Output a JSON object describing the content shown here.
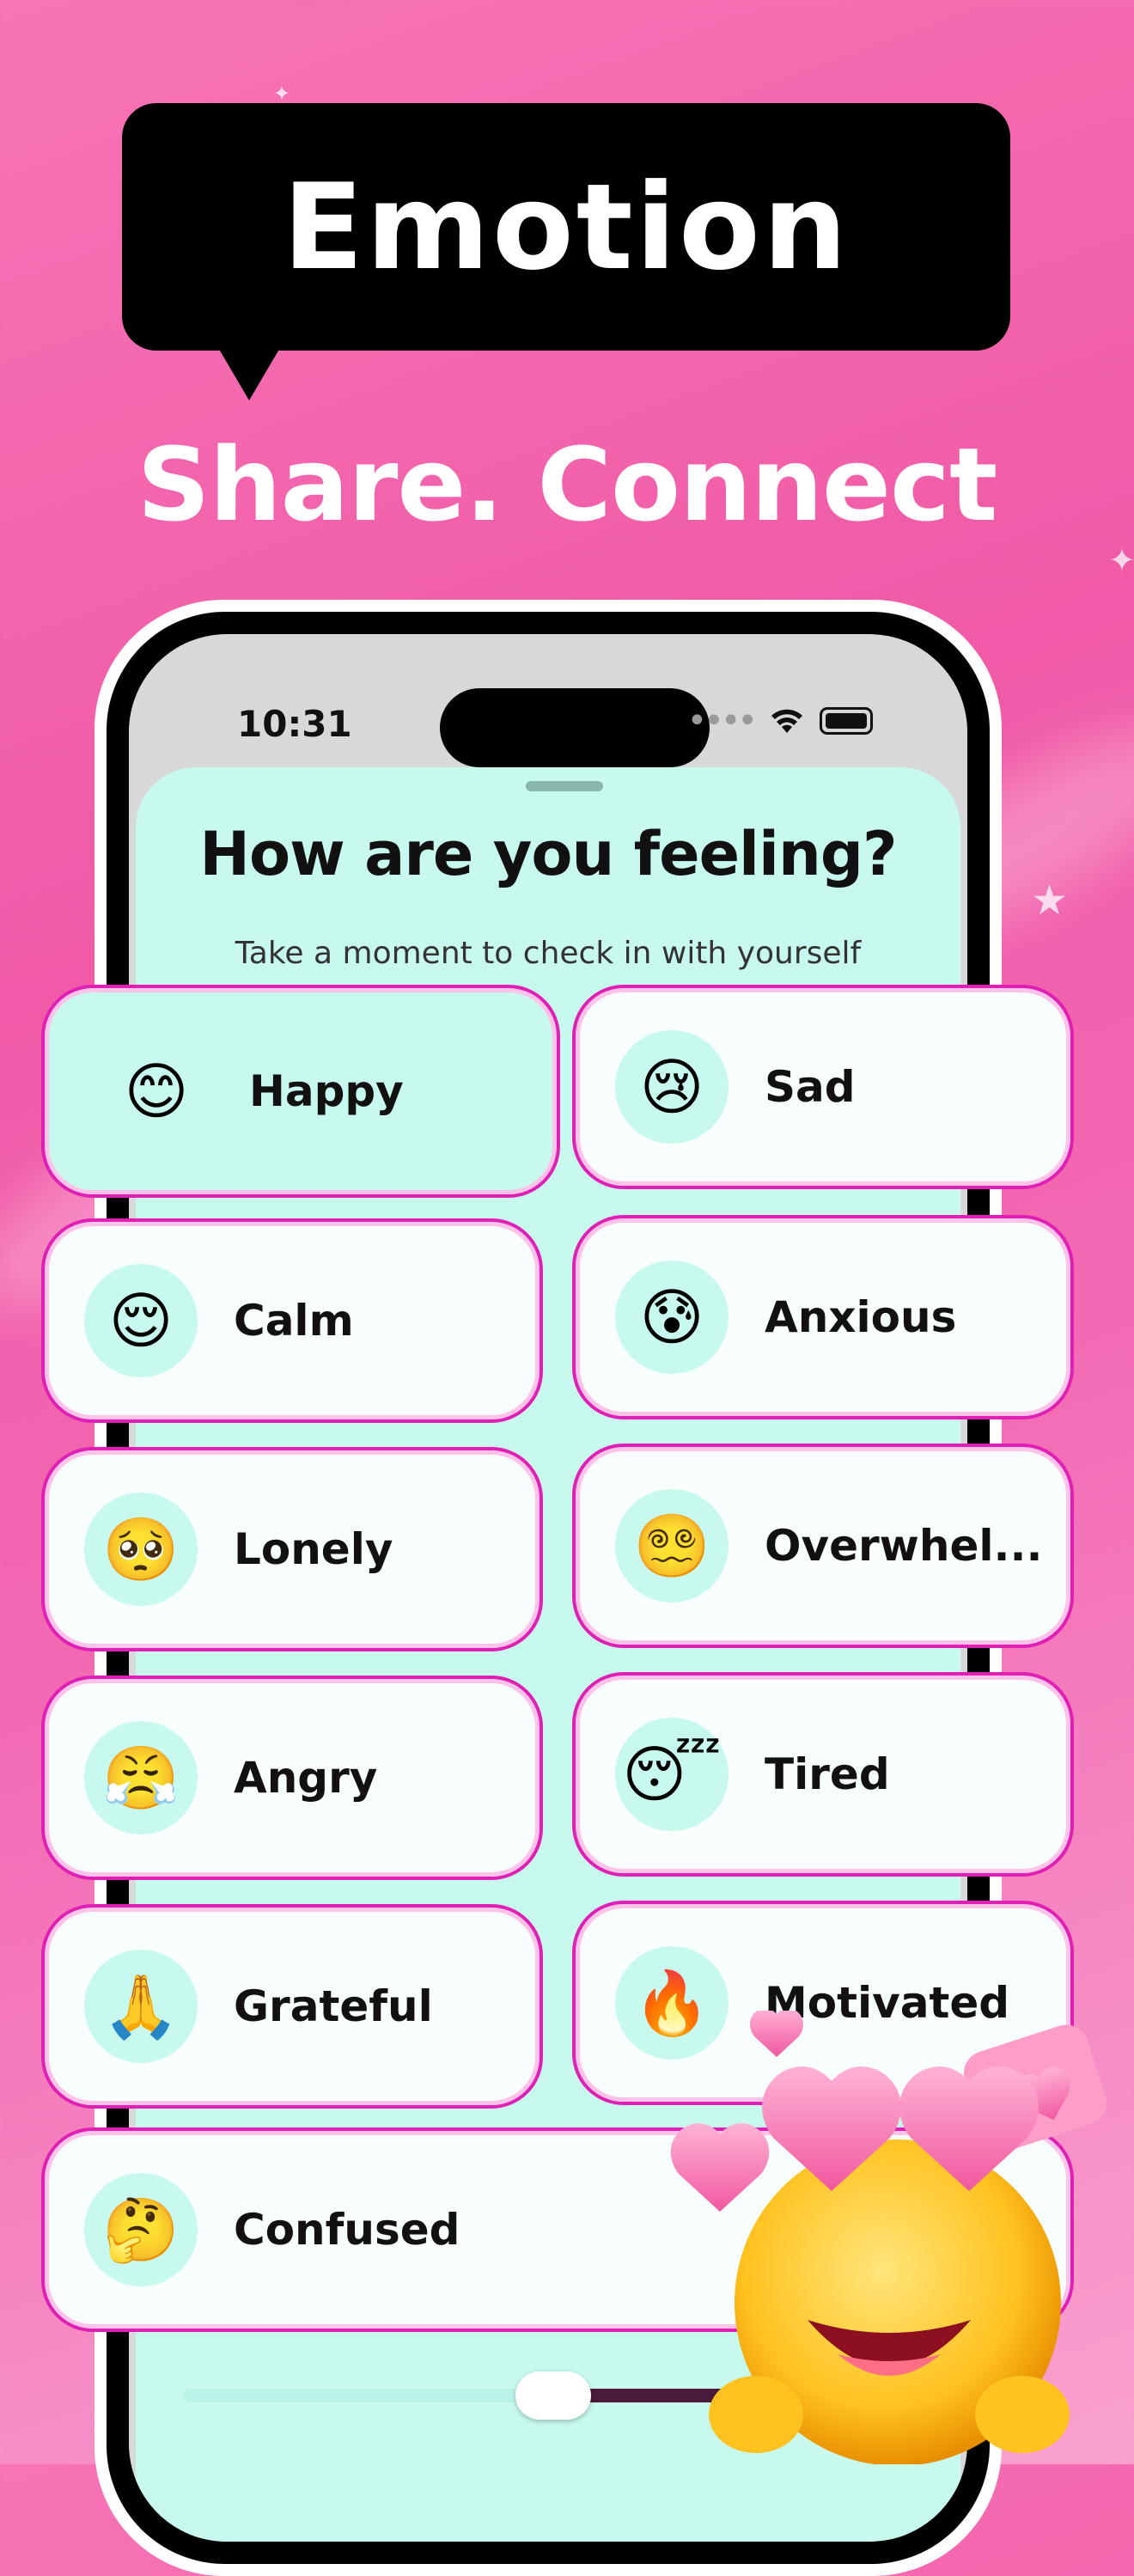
{
  "banner": {
    "title": "Emotion",
    "tagline": "Share. Connect"
  },
  "status_bar": {
    "time": "10:31"
  },
  "sheet": {
    "title": "How are you feeling?",
    "subtitle": "Take a moment to check in with yourself"
  },
  "emotions": [
    {
      "label": "Happy",
      "emoji": "😊",
      "selected": true
    },
    {
      "label": "Sad",
      "emoji": "😢",
      "selected": false
    },
    {
      "label": "Calm",
      "emoji": "😌",
      "selected": false
    },
    {
      "label": "Anxious",
      "emoji": "😰",
      "selected": false
    },
    {
      "label": "Lonely",
      "emoji": "🥺",
      "selected": false
    },
    {
      "label": "Overwhel...",
      "emoji": "😵‍💫",
      "selected": false
    },
    {
      "label": "Angry",
      "emoji": "😤",
      "selected": false
    },
    {
      "label": "Tired",
      "emoji": "😴",
      "selected": false
    },
    {
      "label": "Grateful",
      "emoji": "🙏",
      "selected": false
    },
    {
      "label": "Motivated",
      "emoji": "🔥",
      "selected": false
    },
    {
      "label": "Confused",
      "emoji": "🤔",
      "selected": false
    }
  ],
  "intensity_slider": {
    "level": 0.62
  },
  "colors": {
    "accent_border": "#e020b5",
    "mint": "#c8f9ef",
    "background_pink": "#f05aa6"
  }
}
